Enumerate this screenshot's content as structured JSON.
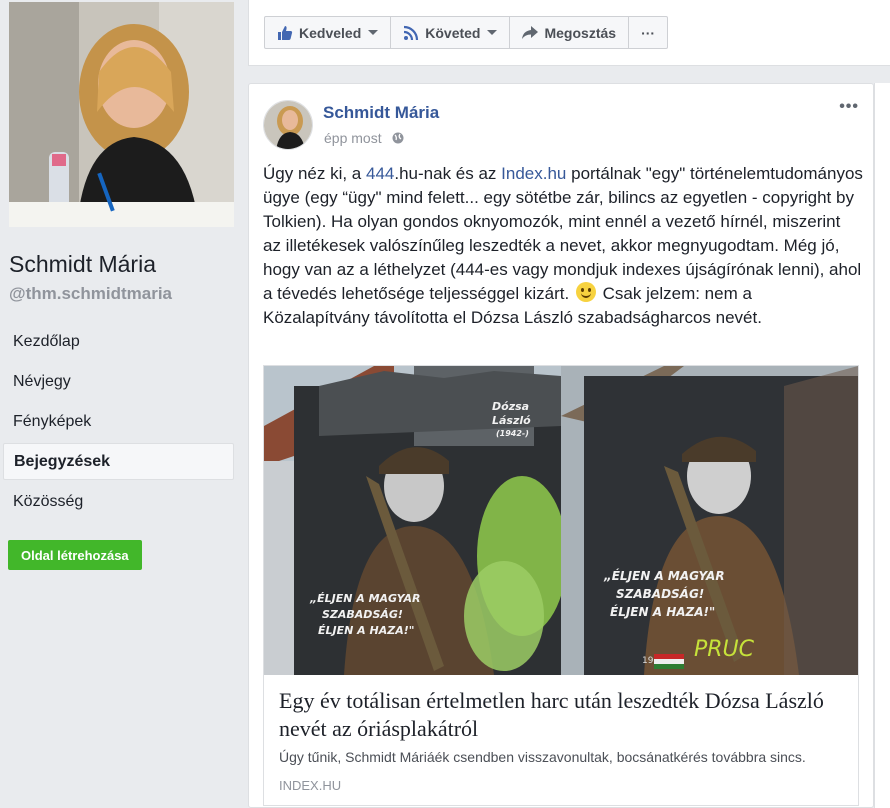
{
  "sidebar": {
    "name": "Schmidt Mária",
    "handle": "@thm.schmidtmaria",
    "nav": [
      {
        "label": "Kezdőlap",
        "active": false
      },
      {
        "label": "Névjegy",
        "active": false
      },
      {
        "label": "Fényképek",
        "active": false
      },
      {
        "label": "Bejegyzések",
        "active": true
      },
      {
        "label": "Közösség",
        "active": false
      }
    ],
    "create_page_label": "Oldal létrehozása"
  },
  "actions": {
    "like_label": "Kedveled",
    "follow_label": "Követed",
    "share_label": "Megosztás",
    "more_label": "···"
  },
  "post": {
    "author": "Schmidt Mária",
    "time": "épp most",
    "more_label": "•••",
    "text": {
      "p1": "Úgy néz ki, a ",
      "link1": "444",
      "p2": ".hu-nak és az ",
      "link2": "Index.hu",
      "p3": " portálnak \"egy\" történelemtudományos ügye (egy “ügy\" mind felett... egy sötétbe zár, bilincs az egyetlen - copyright by Tolkien). Ha olyan gondos oknyomozók, mint ennél a vezető hírnél, miszerint az illetékesek valószínűleg leszedték a nevet, akkor megnyugodtam. Még jó, hogy van az a léthelyzet (444-es vagy mondjuk indexes újságírónak lenni), ahol a tévedés lehetősége teljességgel kizárt. ",
      "p4": " Csak jelzem: nem a Közalapítvány távolította el Dózsa László szabadságharcos nevét."
    },
    "link": {
      "title": "Egy év totálisan értelmetlen harc után leszedték Dózsa László nevét az óriásplakátról",
      "description": "Úgy tűnik, Schmidt Máriáék csendben visszavonultak, bocsánatkérés továbbra sincs.",
      "domain": "INDEX.HU",
      "mural_name_1": "Dózsa",
      "mural_name_2": "László",
      "mural_years": "(1942-)",
      "mural_quote_1": "„ÉLJEN A MAGYAR",
      "mural_quote_2": "SZABADSÁG!",
      "mural_quote_3": "ÉLJEN A HAZA!\"",
      "graffiti": "PRUC",
      "mural_date": "195"
    }
  },
  "colors": {
    "link_blue": "#365899",
    "green": "#42b72a",
    "bg": "#e9ebee"
  }
}
